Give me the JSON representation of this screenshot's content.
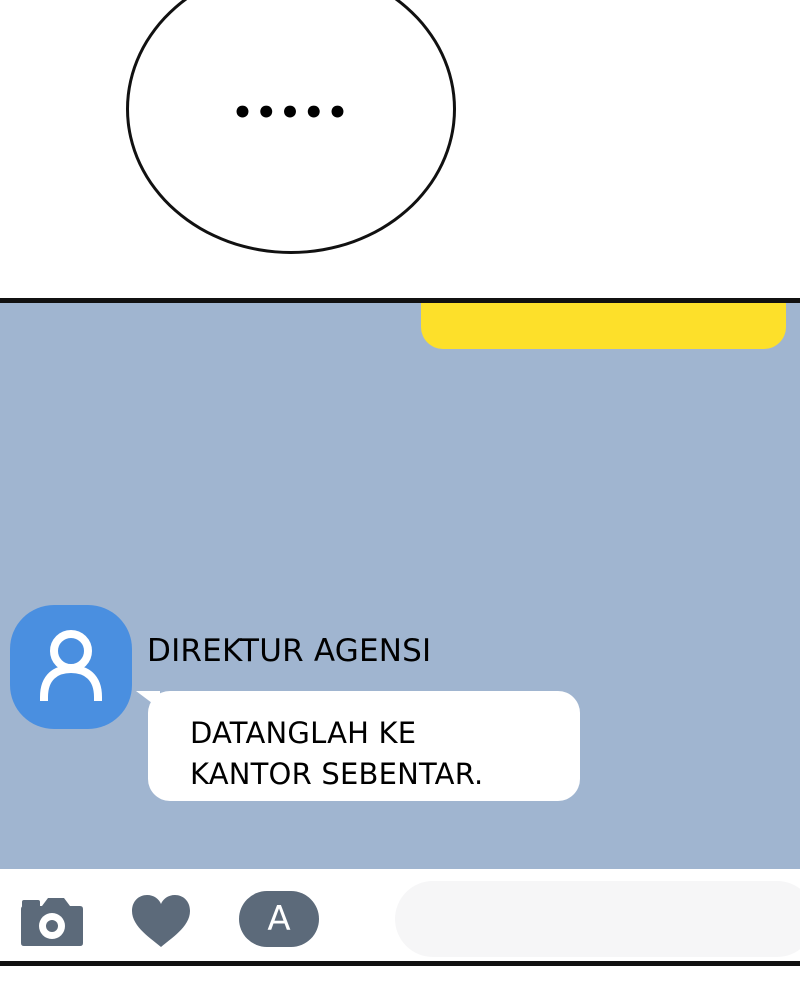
{
  "top_panel": {
    "speech_text": "•••••"
  },
  "chat": {
    "background_color": "#a0b5d0",
    "outgoing_bubble_color": "#fde02a",
    "sender": {
      "name": "DIREKTUR AGENSI",
      "avatar_icon": "person-icon",
      "avatar_color": "#4a8fe0"
    },
    "message": {
      "text": "DATANGLAH KE\nKANTOR SEBENTAR."
    }
  },
  "input_bar": {
    "camera_icon": "camera-icon",
    "heart_icon": "heart-icon",
    "font_button_label": "A",
    "icon_color": "#5c6a7a"
  }
}
